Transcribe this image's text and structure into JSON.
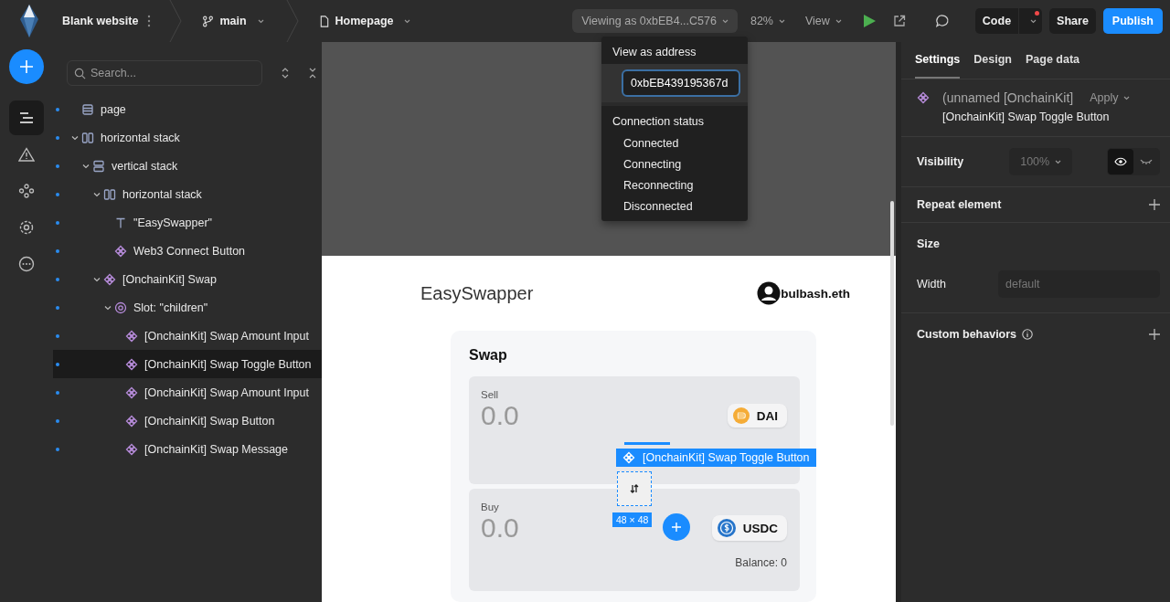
{
  "topbar": {
    "project": "Blank website",
    "branch": "main",
    "page": "Homepage",
    "viewing_as": "Viewing as 0xbEB4...C576",
    "zoom": "82%",
    "view": "View",
    "code": "Code",
    "code_notification": true,
    "share": "Share",
    "publish": "Publish"
  },
  "rail": [
    {
      "kind": "layers",
      "selected": true
    },
    {
      "kind": "warning",
      "selected": false
    },
    {
      "kind": "components",
      "selected": false
    },
    {
      "kind": "settings",
      "selected": false
    },
    {
      "kind": "more",
      "selected": false
    }
  ],
  "search": {
    "placeholder": "Search..."
  },
  "tree": [
    {
      "label": "page",
      "kind": "page",
      "selected": false
    },
    {
      "label": "horizontal stack",
      "kind": "hstack",
      "selected": false,
      "expanded": true,
      "children": [
        {
          "label": "vertical stack",
          "kind": "vstack",
          "selected": false,
          "expanded": true,
          "children": [
            {
              "label": "horizontal stack",
              "kind": "hstack",
              "selected": false,
              "expanded": true,
              "children": [
                {
                  "label": "\"EasySwapper\"",
                  "kind": "text",
                  "selected": false
                },
                {
                  "label": "Web3 Connect Button",
                  "kind": "component",
                  "selected": false
                }
              ]
            },
            {
              "label": "[OnchainKit] Swap",
              "kind": "component",
              "selected": false,
              "expanded": true,
              "children": [
                {
                  "label": "Slot: \"children\"",
                  "kind": "slot",
                  "selected": false,
                  "expanded": true,
                  "children": [
                    {
                      "label": "[OnchainKit] Swap Amount Input",
                      "kind": "component",
                      "selected": false
                    },
                    {
                      "label": "[OnchainKit] Swap Toggle Button",
                      "kind": "component",
                      "selected": true
                    },
                    {
                      "label": "[OnchainKit] Swap Amount Input",
                      "kind": "component",
                      "selected": false
                    },
                    {
                      "label": "[OnchainKit] Swap Button",
                      "kind": "component",
                      "selected": false
                    },
                    {
                      "label": "[OnchainKit] Swap Message",
                      "kind": "component",
                      "selected": false
                    }
                  ]
                }
              ]
            }
          ]
        }
      ]
    }
  ],
  "dropdown": {
    "address_heading": "View as address",
    "address": "0xbEB439195367d",
    "status_heading": "Connection status",
    "statuses": [
      "Connected",
      "Connecting",
      "Reconnecting",
      "Disconnected"
    ]
  },
  "preview": {
    "title": "EasySwapper",
    "account": "bulbash.eth",
    "swap_title": "Swap",
    "sell": {
      "label": "Sell",
      "amount": "0.0",
      "token": "DAI"
    },
    "buy": {
      "label": "Buy",
      "amount": "0.0",
      "token": "USDC",
      "balance": "Balance: 0"
    },
    "selection_label": "[OnchainKit] Swap Toggle Button",
    "selection_size": "48 × 48"
  },
  "panel": {
    "tabs": [
      {
        "label": "Settings",
        "selected": true
      },
      {
        "label": "Design",
        "selected": false
      },
      {
        "label": "Page data",
        "selected": false
      }
    ],
    "component_name": "(unnamed [OnchainKit]",
    "apply": "Apply",
    "component_type": "[OnchainKit] Swap Toggle Button",
    "visibility": {
      "label": "Visibility",
      "opacity": "100%",
      "visible": true
    },
    "repeat": "Repeat element",
    "size": "Size",
    "width_label": "Width",
    "width_placeholder": "default",
    "custom": "Custom behaviors"
  }
}
